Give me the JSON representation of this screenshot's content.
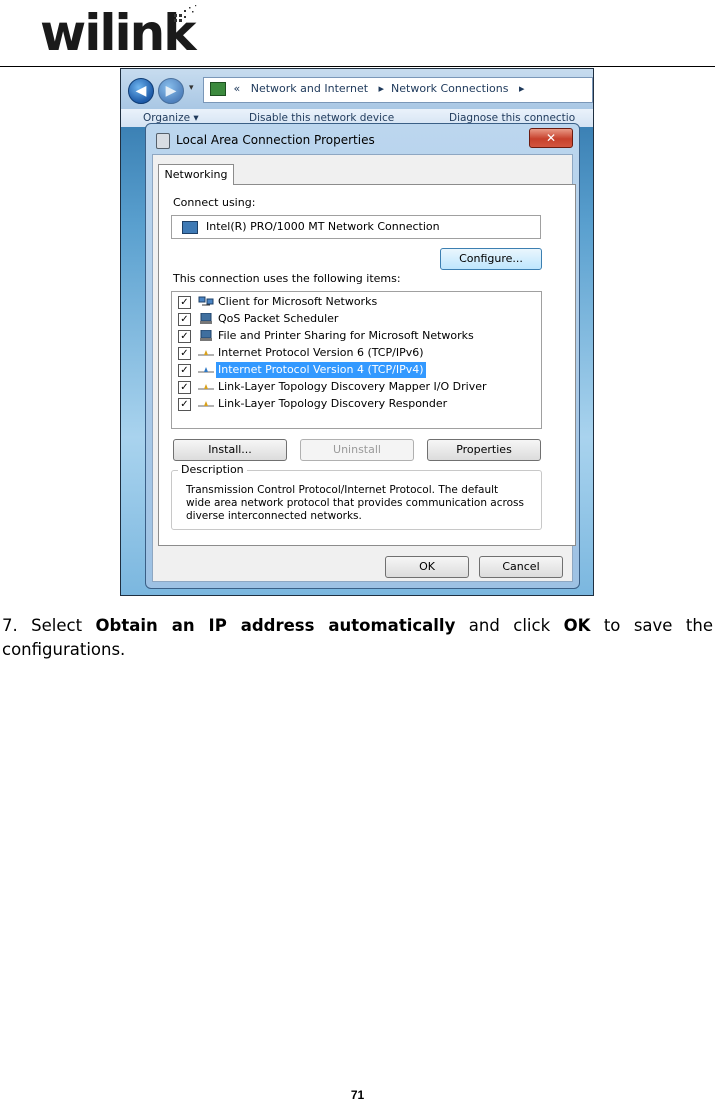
{
  "header": {
    "brand": "wilink"
  },
  "screenshot": {
    "breadcrumb": {
      "sep": "«",
      "part1": "Network and Internet",
      "part2": "Network Connections"
    },
    "commands": [
      "Organize ▾",
      "Disable this network device",
      "Diagnose this connectio"
    ],
    "dialog": {
      "title": "Local Area Connection Properties",
      "close_label": "✕",
      "tab": "Networking",
      "connect_using_label": "Connect using:",
      "adapter": "Intel(R) PRO/1000 MT Network Connection",
      "configure_label": "Configure...",
      "items_label": "This connection uses the following items:",
      "items": [
        {
          "label": "Client for Microsoft Networks",
          "checked": true,
          "selected": false
        },
        {
          "label": "QoS Packet Scheduler",
          "checked": true,
          "selected": false
        },
        {
          "label": "File and Printer Sharing for Microsoft Networks",
          "checked": true,
          "selected": false
        },
        {
          "label": "Internet Protocol Version 6 (TCP/IPv6)",
          "checked": true,
          "selected": false
        },
        {
          "label": "Internet Protocol Version 4 (TCP/IPv4)",
          "checked": true,
          "selected": true
        },
        {
          "label": "Link-Layer Topology Discovery Mapper I/O Driver",
          "checked": true,
          "selected": false
        },
        {
          "label": "Link-Layer Topology Discovery Responder",
          "checked": true,
          "selected": false
        }
      ],
      "install_label": "Install...",
      "uninstall_label": "Uninstall",
      "properties_label": "Properties",
      "description_legend": "Description",
      "description_text": "Transmission Control Protocol/Internet Protocol. The default wide area network protocol that provides communication across diverse interconnected networks.",
      "ok_label": "OK",
      "cancel_label": "Cancel"
    }
  },
  "caption": {
    "prefix": "7. Select ",
    "bold1": "Obtain an IP address automatically",
    "middle": " and click ",
    "bold2": "OK",
    "suffix": " to save the configurations."
  },
  "page_number": "71"
}
